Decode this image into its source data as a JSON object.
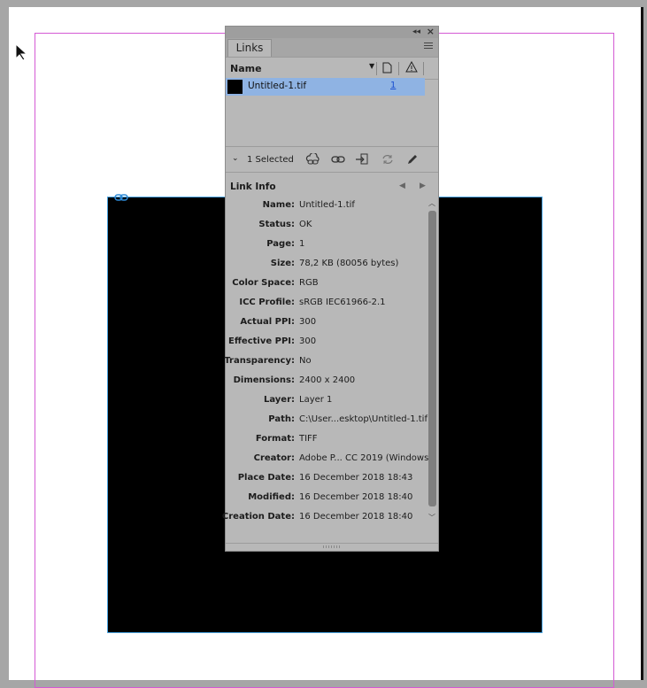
{
  "panel": {
    "tab_label": "Links",
    "column_name": "Name",
    "links": [
      {
        "name": "Untitled-1.tif",
        "page": "1"
      }
    ],
    "selected_text": "1 Selected",
    "link_info_title": "Link Info",
    "info": [
      {
        "label": "Name:",
        "value": "Untitled-1.tif"
      },
      {
        "label": "Status:",
        "value": "OK"
      },
      {
        "label": "Page:",
        "value": "1"
      },
      {
        "label": "Size:",
        "value": "78,2 KB (80056 bytes)"
      },
      {
        "label": "Color Space:",
        "value": "RGB"
      },
      {
        "label": "ICC Profile:",
        "value": "sRGB IEC61966-2.1"
      },
      {
        "label": "Actual PPI:",
        "value": "300"
      },
      {
        "label": "Effective PPI:",
        "value": "300"
      },
      {
        "label": "Transparency:",
        "value": "No"
      },
      {
        "label": "Dimensions:",
        "value": "2400 x 2400"
      },
      {
        "label": "Layer:",
        "value": "Layer 1"
      },
      {
        "label": "Path:",
        "value": "C:\\User...esktop\\Untitled-1.tif"
      },
      {
        "label": "Format:",
        "value": "TIFF"
      },
      {
        "label": "Creator:",
        "value": "Adobe P... CC 2019 (Windows)"
      },
      {
        "label": "Place Date:",
        "value": "16 December 2018 18:43"
      },
      {
        "label": "Modified:",
        "value": "16 December 2018 18:40"
      },
      {
        "label": "Creation Date:",
        "value": "16 December 2018 18:40"
      }
    ]
  },
  "icons": {
    "cursor": "arrow-cursor-icon",
    "collapse": "double-chevron-left-icon",
    "close": "close-icon",
    "menu": "panel-menu-icon",
    "sort": "sort-dropdown-icon",
    "page_column": "page-icon",
    "status_column": "warning-icon",
    "cloud_link": "cloud-link-icon",
    "relink": "relink-icon",
    "go_to_link": "go-to-link-icon",
    "update": "update-link-icon",
    "edit": "edit-original-icon",
    "link_badge": "link-badge-icon"
  },
  "colors": {
    "selection": "#8fb3e3",
    "guide": "#d45ad4",
    "frame": "#4aa3e0"
  }
}
